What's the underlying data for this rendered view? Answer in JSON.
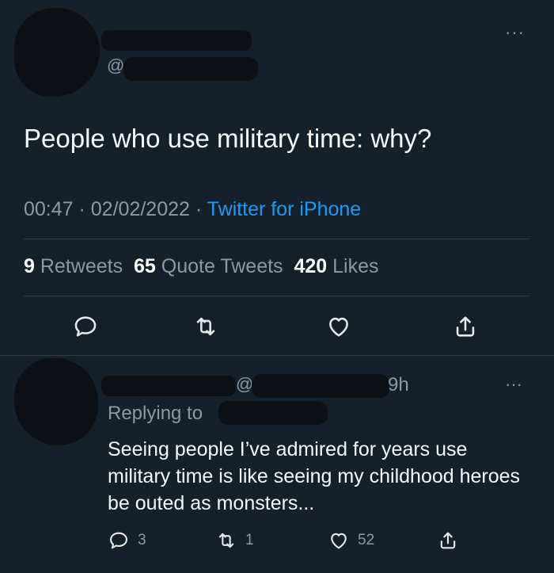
{
  "tweet": {
    "at_symbol": "@",
    "more": "···",
    "text": "People who use military time: why?",
    "time": "00:47",
    "sep": " · ",
    "date": "02/02/2022",
    "client": "Twitter for iPhone",
    "retweets_count": "9",
    "retweets_label": "Retweets",
    "quotes_count": "65",
    "quotes_label": "Quote Tweets",
    "likes_count": "420",
    "likes_label": "Likes"
  },
  "reply": {
    "at_symbol": "@",
    "time": "9h",
    "more": "···",
    "replying_to": "Replying to",
    "text": "Seeing people I’ve admired for years use military time is like seeing my childhood heroes be outed as monsters...",
    "reply_count": "3",
    "retweet_count": "1",
    "like_count": "52"
  },
  "icons": [
    "comment-icon",
    "retweet-icon",
    "like-icon",
    "share-icon"
  ],
  "colors": {
    "background": "#15202b",
    "accent": "#1d9bf0",
    "secondary_text": "#8b98a5",
    "divider": "#2f3d4b"
  }
}
